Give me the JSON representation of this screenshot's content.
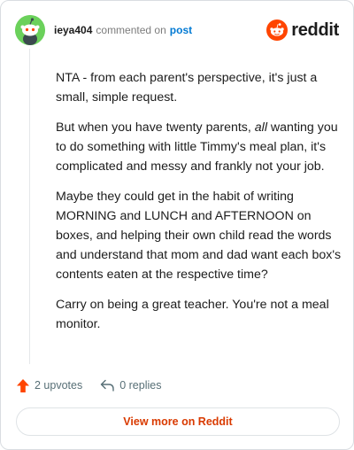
{
  "header": {
    "username": "ieya404",
    "action": "commented on",
    "post_link": "post",
    "brand": "reddit"
  },
  "comment": {
    "p1": "NTA - from each parent's perspective, it's just a small, simple request.",
    "p2_before": "But when you have twenty parents, ",
    "p2_emph": "all",
    "p2_after": " wanting you to do something with little Timmy's meal plan, it's complicated and messy and frankly not your job.",
    "p3": "Maybe they could get in the habit of writing MORNING and LUNCH and AFTERNOON on boxes, and helping their own child read the words and understand that mom and dad want each box's contents eaten at the respective time?",
    "p4": "Carry on being a great teacher. You're not a meal monitor."
  },
  "footer": {
    "upvotes_label": "2 upvotes",
    "replies_label": "0 replies"
  },
  "view_more_label": "View more on Reddit",
  "colors": {
    "accent_orange": "#ff4500",
    "link_blue": "#0079d3",
    "avatar_green": "#6bd15b",
    "button_text": "#d93a00"
  },
  "icons": [
    "snoo-avatar-icon",
    "reddit-logo-icon",
    "upvote-arrow-icon",
    "reply-arrow-icon"
  ]
}
